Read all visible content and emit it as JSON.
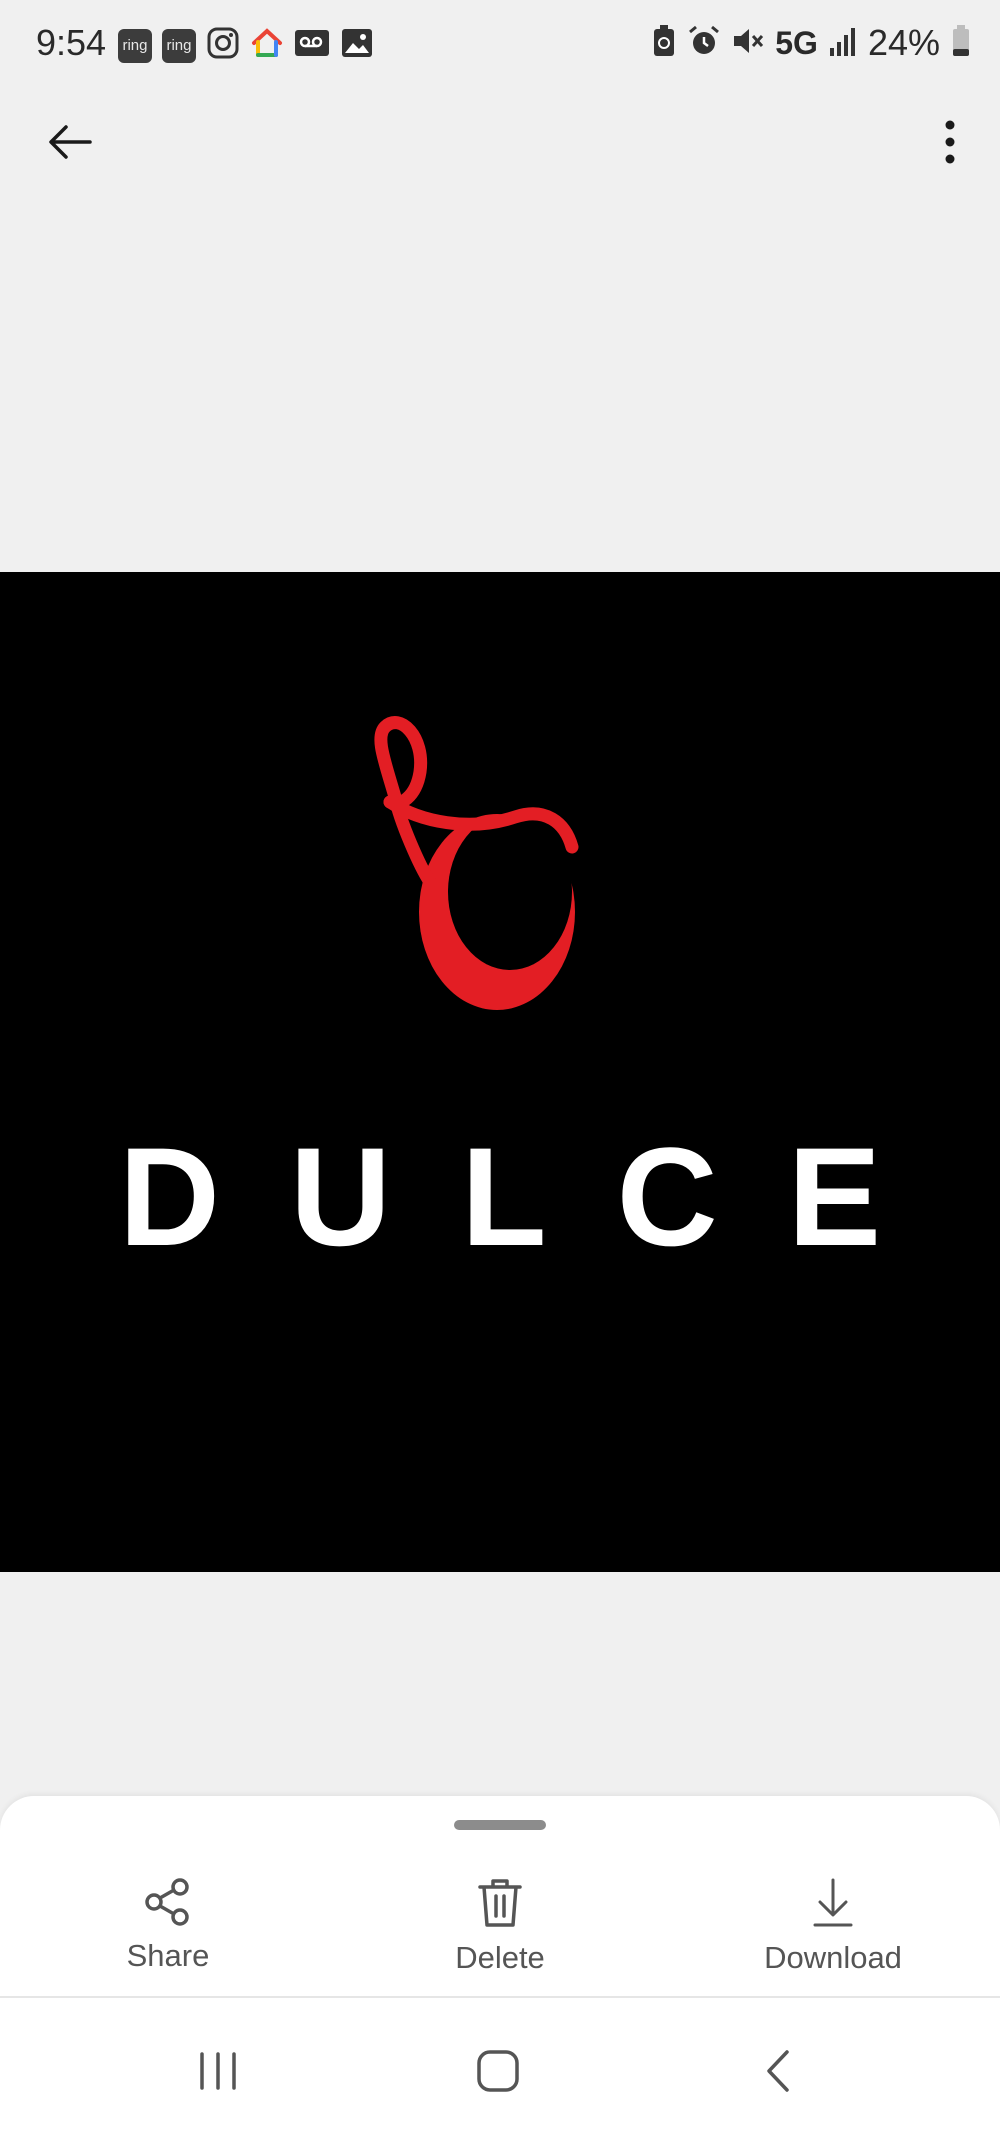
{
  "status_bar": {
    "time": "9:54",
    "notification_icons": [
      "ring-icon",
      "ring-icon",
      "instagram-icon",
      "google-home-icon",
      "voicemail-icon",
      "gallery-icon"
    ],
    "ring_label": "ring",
    "system_icons": [
      "battery-saver-icon",
      "alarm-icon",
      "mute-icon",
      "signal-icon",
      "battery-icon"
    ],
    "network": "5G",
    "battery": "24%"
  },
  "header": {
    "back_icon": "arrow-left-icon",
    "menu_icon": "more-vertical-icon"
  },
  "image": {
    "brand_text": "DULCE",
    "background": "#000000",
    "logo_color": "#e31e24",
    "text_color": "#ffffff"
  },
  "actions": [
    {
      "label": "Share",
      "icon": "share-icon"
    },
    {
      "label": "Delete",
      "icon": "trash-icon"
    },
    {
      "label": "Download",
      "icon": "download-icon"
    }
  ],
  "nav_bar": {
    "buttons": [
      "recents-icon",
      "home-icon",
      "back-icon"
    ]
  }
}
